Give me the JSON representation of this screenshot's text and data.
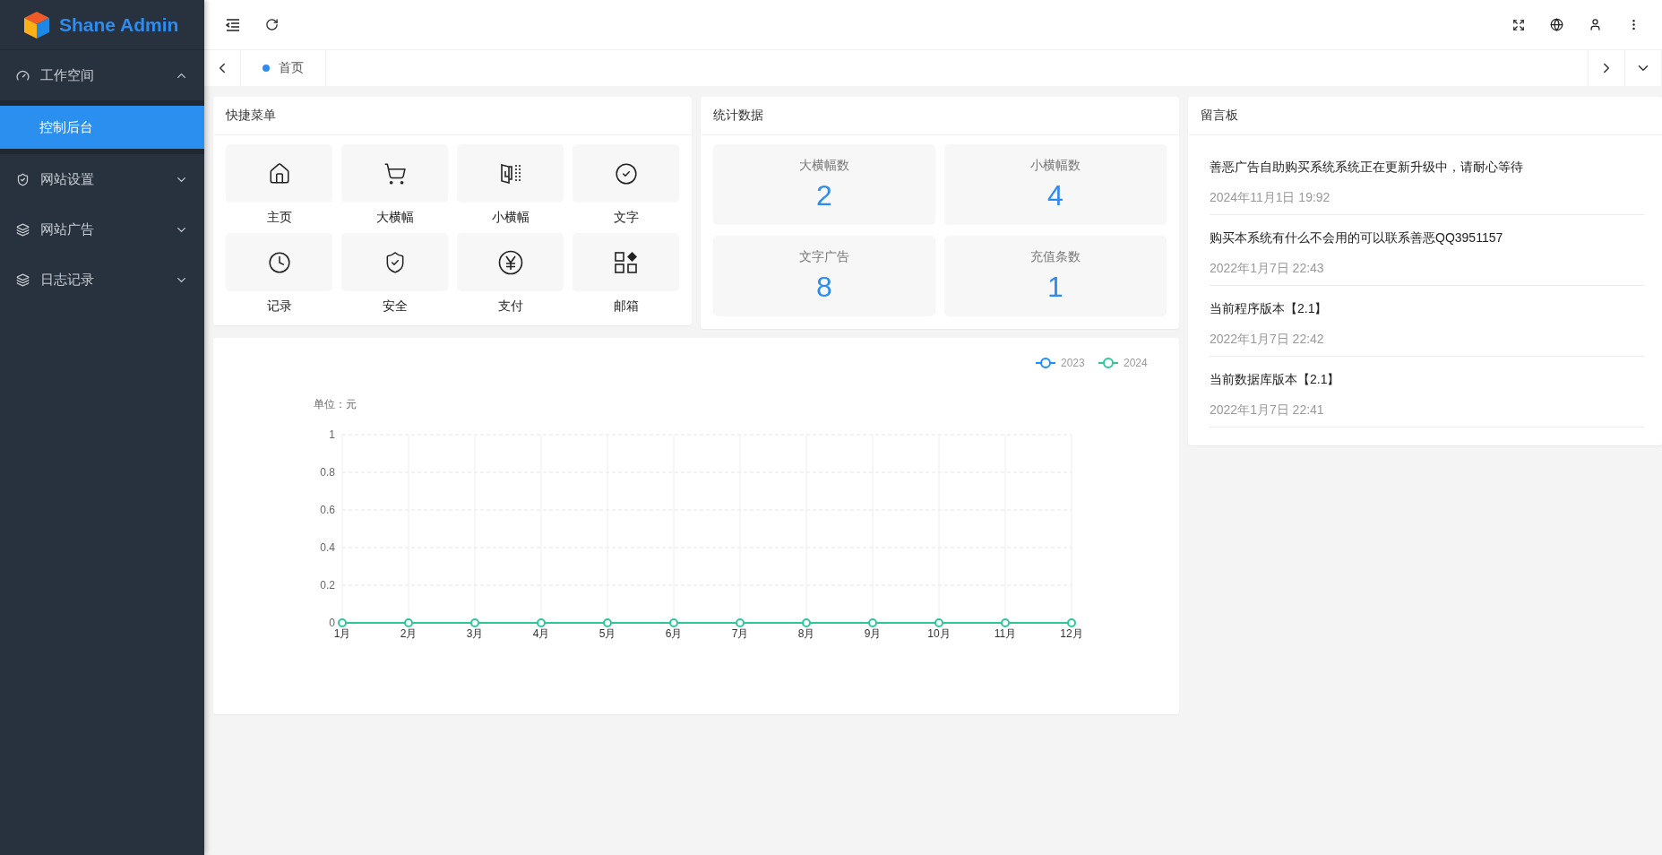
{
  "header": {
    "brand": "Shane Admin"
  },
  "sidebar": {
    "items": [
      {
        "label": "工作空间",
        "expanded": true,
        "children": [
          {
            "label": "控制后台",
            "selected": true
          }
        ]
      },
      {
        "label": "网站设置",
        "expanded": false
      },
      {
        "label": "网站广告",
        "expanded": false
      },
      {
        "label": "日志记录",
        "expanded": false
      }
    ]
  },
  "tabs": [
    {
      "label": "首页",
      "selected": true
    }
  ],
  "quick_menu": {
    "title": "快捷菜单",
    "items": [
      {
        "label": "主页"
      },
      {
        "label": "大横幅"
      },
      {
        "label": "小横幅"
      },
      {
        "label": "文字"
      },
      {
        "label": "记录"
      },
      {
        "label": "安全"
      },
      {
        "label": "支付"
      },
      {
        "label": "邮箱"
      }
    ]
  },
  "stats": {
    "title": "统计数据",
    "items": [
      {
        "label": "大横幅数",
        "value": "2"
      },
      {
        "label": "小横幅数",
        "value": "4"
      },
      {
        "label": "文字广告",
        "value": "8"
      },
      {
        "label": "充值条数",
        "value": "1"
      }
    ]
  },
  "chart_card": {
    "chart_data": {
      "type": "line",
      "ylabel": "单位：元",
      "categories": [
        "1月",
        "2月",
        "3月",
        "4月",
        "5月",
        "6月",
        "7月",
        "8月",
        "9月",
        "10月",
        "11月",
        "12月"
      ],
      "series": [
        {
          "name": "2023",
          "color": "#1890ff",
          "marker": "circle",
          "values": [
            null,
            null,
            null,
            null,
            null,
            null,
            null,
            null,
            null,
            null,
            null,
            null
          ]
        },
        {
          "name": "2024",
          "color": "#2fc79a",
          "marker": "circle",
          "values": [
            0,
            0,
            0,
            0,
            0,
            0,
            0,
            0,
            0,
            0,
            0,
            0
          ]
        }
      ],
      "ylim": [
        0,
        1
      ],
      "yticks": [
        0,
        0.2,
        0.4,
        0.6,
        0.8,
        1
      ],
      "grid": true,
      "legend": true
    }
  },
  "message_board": {
    "title": "留言板",
    "messages": [
      {
        "text": "善恶广告自助购买系统系统正在更新升级中，请耐心等待",
        "time": "2024年11月1日 19:92"
      },
      {
        "text": "购买本系统有什么不会用的可以联系善恶QQ3951157",
        "time": "2022年1月7日 22:43"
      },
      {
        "text": "当前程序版本【2.1】",
        "time": "2022年1月7日 22:42"
      },
      {
        "text": "当前数据库版本【2.1】",
        "time": "2022年1月7日 22:41"
      }
    ]
  }
}
